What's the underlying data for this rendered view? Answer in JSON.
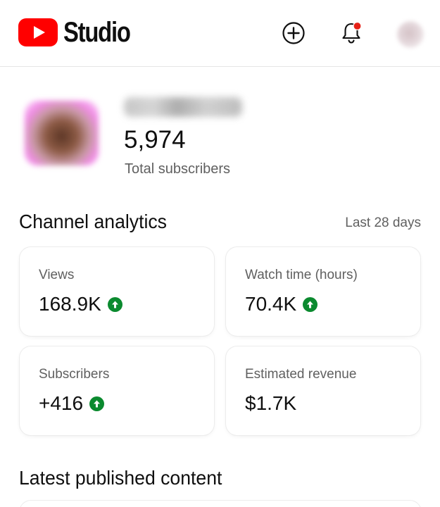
{
  "header": {
    "app_name": "Studio",
    "icons": {
      "logo": "youtube-play-logo",
      "create": "create-plus-icon",
      "notifications": "bell-icon",
      "account": "account-avatar"
    },
    "colors": {
      "brand": "#ff0000",
      "notification_dot": "#e62117"
    }
  },
  "channel": {
    "subscriber_count": "5,974",
    "subscriber_label": "Total subscribers"
  },
  "analytics": {
    "title": "Channel analytics",
    "period": "Last 28 days",
    "up_color": "#0b8a2f",
    "cards": [
      {
        "label": "Views",
        "value": "168.9K",
        "trend": "up"
      },
      {
        "label": "Watch time (hours)",
        "value": "70.4K",
        "trend": "up"
      },
      {
        "label": "Subscribers",
        "value": "+416",
        "trend": "up"
      },
      {
        "label": "Estimated revenue",
        "value": "$1.7K",
        "trend": "none"
      }
    ]
  },
  "latest": {
    "title": "Latest published content"
  }
}
